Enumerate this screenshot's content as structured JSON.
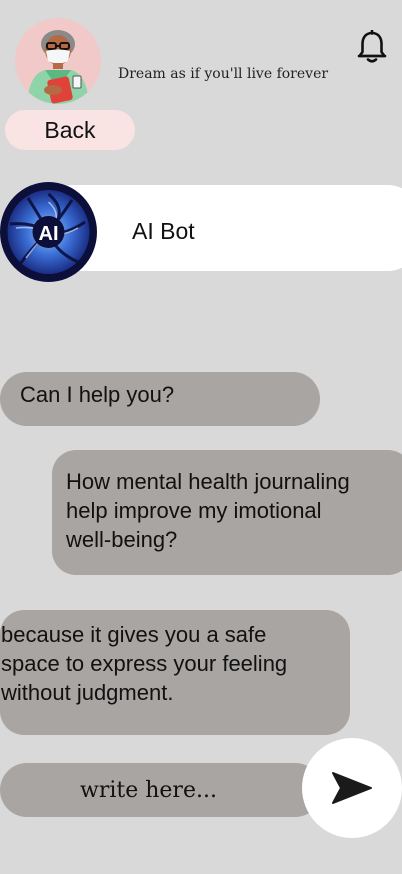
{
  "header": {
    "quote": "Dream as if you'll live forever",
    "avatar_icon": "doctor-avatar-icon",
    "bell_icon": "bell-icon"
  },
  "nav": {
    "back_label": "Back"
  },
  "bot": {
    "name": "AI Bot",
    "logo_text": "AI",
    "logo_icon": "ai-bot-logo-icon"
  },
  "messages": [
    {
      "sender": "bot",
      "text": "Can I help you?"
    },
    {
      "sender": "user",
      "text": "How mental health  journaling\nhelp improve my imotional\nwell-being?"
    },
    {
      "sender": "bot",
      "text": "because it gives you a safe\nspace to express your feeling\nwithout judgment."
    }
  ],
  "composer": {
    "placeholder": "write here...",
    "send_icon": "send-icon"
  },
  "colors": {
    "background": "#d9d9d9",
    "bubble": "#a9a5a3",
    "back_button": "#f9e3e3",
    "card": "#ffffff",
    "logo_dark": "#0b0f3a",
    "logo_blue": "#2f63c9"
  }
}
